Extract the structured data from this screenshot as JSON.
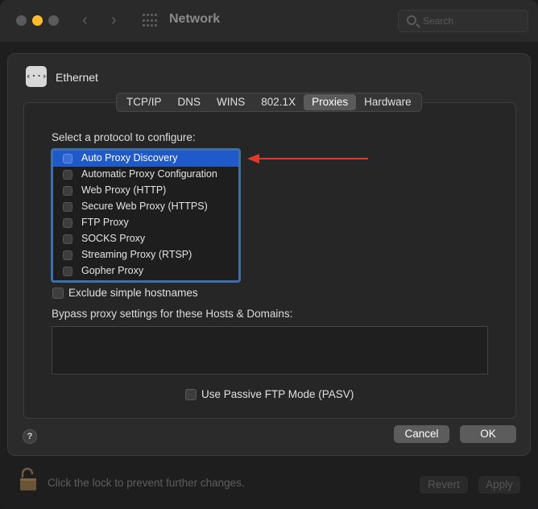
{
  "window": {
    "title": "Network",
    "search_placeholder": "Search",
    "nav_back": "‹",
    "nav_forward": "›"
  },
  "interface": {
    "name": "Ethernet",
    "icon": "ethernet-icon",
    "icon_glyph": "‹··›"
  },
  "tabs": [
    {
      "label": "TCP/IP",
      "active": false
    },
    {
      "label": "DNS",
      "active": false
    },
    {
      "label": "WINS",
      "active": false
    },
    {
      "label": "802.1X",
      "active": false
    },
    {
      "label": "Proxies",
      "active": true
    },
    {
      "label": "Hardware",
      "active": false
    }
  ],
  "proxies": {
    "select_label": "Select a protocol to configure:",
    "protocols": [
      {
        "label": "Auto Proxy Discovery",
        "selected": true,
        "checked": false
      },
      {
        "label": "Automatic Proxy Configuration",
        "selected": false,
        "checked": false
      },
      {
        "label": "Web Proxy (HTTP)",
        "selected": false,
        "checked": false
      },
      {
        "label": "Secure Web Proxy (HTTPS)",
        "selected": false,
        "checked": false
      },
      {
        "label": "FTP Proxy",
        "selected": false,
        "checked": false
      },
      {
        "label": "SOCKS Proxy",
        "selected": false,
        "checked": false
      },
      {
        "label": "Streaming Proxy (RTSP)",
        "selected": false,
        "checked": false
      },
      {
        "label": "Gopher Proxy",
        "selected": false,
        "checked": false
      }
    ],
    "exclude_simple_hostnames": {
      "label": "Exclude simple hostnames",
      "checked": false
    },
    "bypass_label": "Bypass proxy settings for these Hosts & Domains:",
    "bypass_value": "",
    "passive_ftp": {
      "label": "Use Passive FTP Mode (PASV)",
      "checked": false
    }
  },
  "buttons": {
    "help": "?",
    "cancel": "Cancel",
    "ok": "OK"
  },
  "footer": {
    "lock_text": "Click the lock to prevent further changes.",
    "revert": "Revert",
    "apply": "Apply"
  },
  "colors": {
    "selection": "#2059c8",
    "list_focus_ring": "#3f6fa8",
    "annotation_arrow": "#e0392b",
    "minimize_yellow": "#febc2e"
  }
}
